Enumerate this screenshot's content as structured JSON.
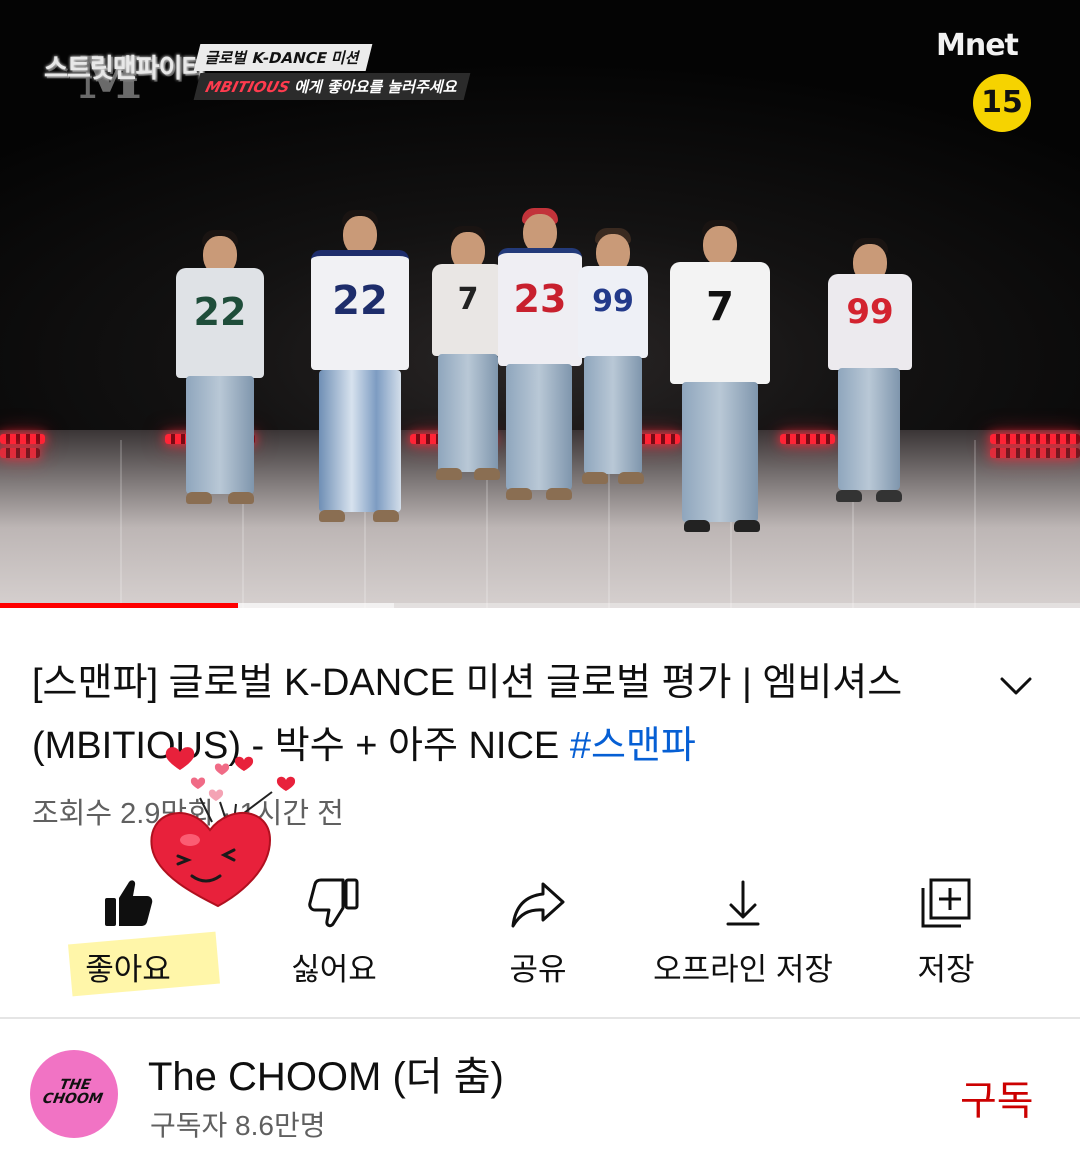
{
  "player": {
    "show_logo": "스트릿맨파이터",
    "show_logo_mark": "M",
    "caption_line1": "글로벌 K-DANCE 미션",
    "caption_brand": "MBITIOUS",
    "caption_line2": "에게 좋아요를 눌러주세요",
    "network": "Mnet",
    "age_rating": "15",
    "progress_played_fraction": 0.22,
    "progress_buffered_fraction": 0.365,
    "jersey_numbers": [
      "22",
      "22",
      "7",
      "23",
      "99",
      "7",
      "99"
    ]
  },
  "video": {
    "title_text": "[스맨파] 글로벌 K-DANCE 미션 글로벌 평가 | 엠비셔스(MBITIOUS) - 박수 + 아주 NICE ",
    "hashtag": "#스맨파",
    "meta": "조회수 2.9만회 · 1시간 전"
  },
  "actions": {
    "like_label": "좋아요",
    "dislike_label": "싫어요",
    "share_label": "공유",
    "download_label": "오프라인 저장",
    "save_label": "저장"
  },
  "channel": {
    "avatar_text_1": "THE",
    "avatar_text_2": "CHOOM",
    "name": "The CHOOM (더 춤)",
    "subscribers": "구독자 8.6만명",
    "subscribe_label": "구독"
  },
  "colors": {
    "accent_red": "#ff0000",
    "subscribe_red": "#cc0000",
    "hashtag_blue": "#065fd4",
    "avatar_pink": "#f173c4",
    "age_badge_yellow": "#f6d300"
  }
}
